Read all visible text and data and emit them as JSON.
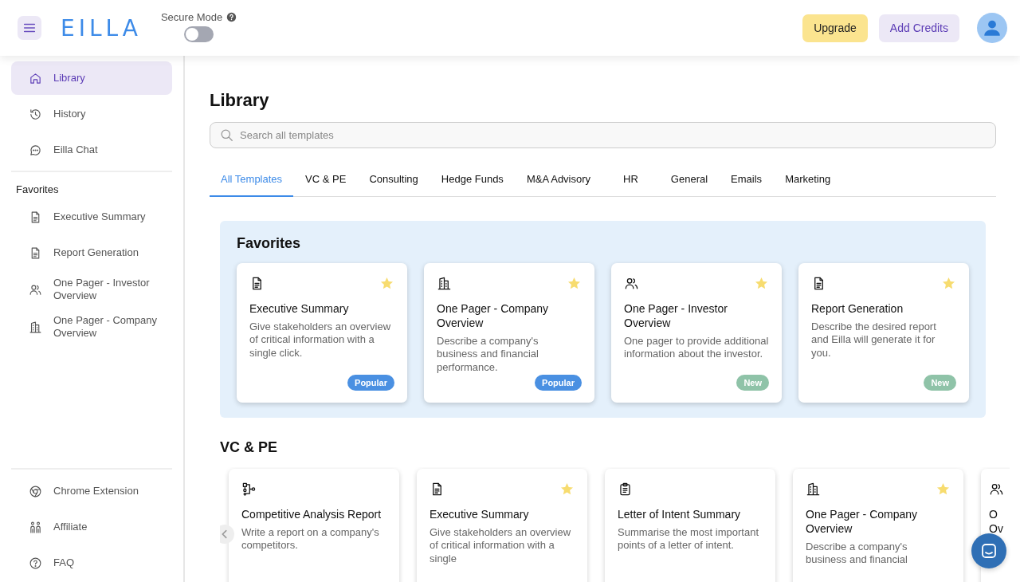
{
  "header": {
    "logo": "EILLA",
    "secure_mode": {
      "label": "Secure Mode",
      "on": false
    },
    "buttons": [
      {
        "label": "Upgrade",
        "kind": "upgrade"
      },
      {
        "label": "Add Credits",
        "kind": "credits"
      }
    ]
  },
  "sidebar": {
    "nav": [
      {
        "label": "Library",
        "kind": "home",
        "selected": true
      },
      {
        "label": "History",
        "kind": "history",
        "selected": false
      },
      {
        "label": "Eilla Chat",
        "kind": "chat",
        "selected": false
      }
    ],
    "favorites_title": "Favorites",
    "favorites": [
      {
        "label": "Executive Summary",
        "kind": "doc"
      },
      {
        "label": "Report Generation",
        "kind": "doc"
      },
      {
        "label": "One Pager - Investor Overview",
        "kind": "users"
      },
      {
        "label": "One Pager - Company Overview",
        "kind": "building"
      }
    ],
    "footer": [
      {
        "label": "Chrome Extension",
        "kind": "chrome"
      },
      {
        "label": "Affiliate",
        "kind": "people"
      },
      {
        "label": "FAQ",
        "kind": "help"
      }
    ]
  },
  "main": {
    "title": "Library",
    "search": {
      "placeholder": "Search all templates"
    },
    "tabs": [
      {
        "label": "All Templates",
        "selected": true
      },
      {
        "label": "VC & PE",
        "selected": false
      },
      {
        "label": "Consulting",
        "selected": false
      },
      {
        "label": "Hedge Funds",
        "selected": false
      },
      {
        "label": "M&A Advisory",
        "selected": false
      },
      {
        "label": "HR",
        "selected": false
      },
      {
        "label": "General",
        "selected": false
      },
      {
        "label": "Emails",
        "selected": false
      },
      {
        "label": "Marketing",
        "selected": false
      }
    ],
    "sections": [
      {
        "title": "Favorites",
        "kind": "panel",
        "cards": [
          {
            "kind": "doc",
            "title": "Executive Summary",
            "description": "Give stakeholders an overview of critical information with a single click.",
            "starred": true,
            "badge": {
              "label": "Popular",
              "kind": "popular"
            }
          },
          {
            "kind": "building",
            "title": "One Pager - Company Overview",
            "description": "Describe a company's business and financial performance.",
            "starred": true,
            "badge": {
              "label": "Popular",
              "kind": "popular"
            }
          },
          {
            "kind": "users",
            "title": "One Pager - Investor Overview",
            "description": "One pager to provide additional information about the investor.",
            "starred": true,
            "badge": {
              "label": "New",
              "kind": "new"
            }
          },
          {
            "kind": "doc",
            "title": "Report Generation",
            "description": "Describe the desired report and Eilla will generate it for you.",
            "starred": true,
            "badge": {
              "label": "New",
              "kind": "new"
            }
          }
        ]
      },
      {
        "title": "VC & PE",
        "kind": "carousel",
        "cards": [
          {
            "kind": "flow",
            "title": "Competitive Analysis Report",
            "description": "Write a report on a company's competitors.",
            "starred": false
          },
          {
            "kind": "doc",
            "title": "Executive Summary",
            "description": "Give stakeholders an overview of critical information with a single",
            "starred": true
          },
          {
            "kind": "clipboard",
            "title": "Letter of Intent Summary",
            "description": "Summarise the most important points of a letter of intent.",
            "starred": false
          },
          {
            "kind": "building",
            "title": "One Pager - Company Overview",
            "description": "Describe a company's business and financial",
            "starred": true
          },
          {
            "kind": "users",
            "partial": true,
            "title_lines": [
              "O",
              "Ov"
            ]
          }
        ]
      }
    ]
  }
}
